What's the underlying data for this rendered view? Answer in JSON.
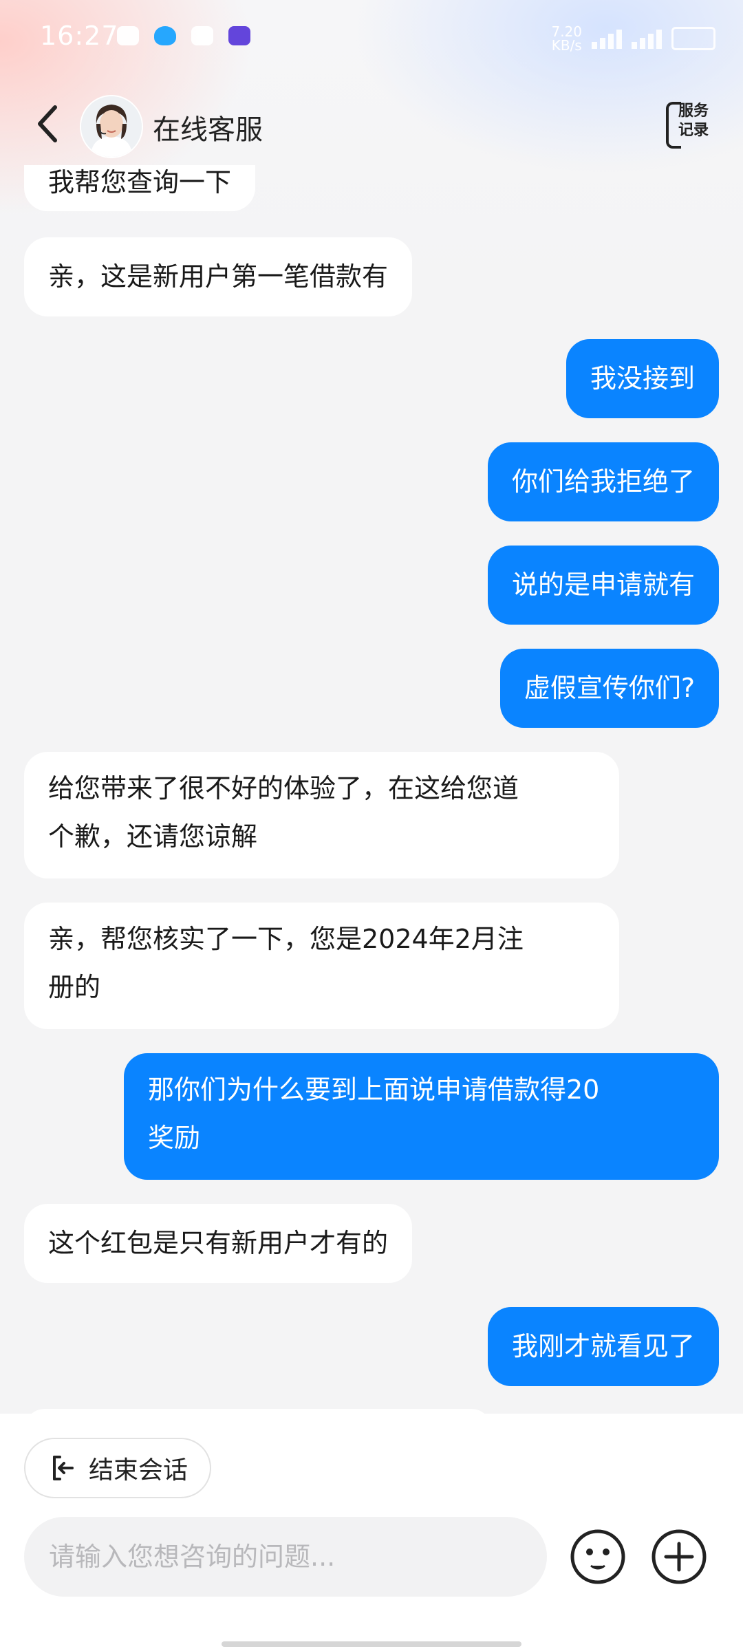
{
  "status_bar": {
    "time": "16:27",
    "net_speed_value": "7.20",
    "net_speed_unit": "KB/s"
  },
  "header": {
    "title": "在线客服",
    "service_record_label_1": "服务",
    "service_record_label_2": "记录"
  },
  "messages": [
    {
      "side": "left",
      "text": "我帮您查询一下"
    },
    {
      "side": "left",
      "text": "亲，这是新用户第一笔借款有"
    },
    {
      "side": "right",
      "text": "我没接到"
    },
    {
      "side": "right",
      "text": "你们给我拒绝了"
    },
    {
      "side": "right",
      "text": "说的是申请就有"
    },
    {
      "side": "right",
      "text": "虚假宣传你们?"
    },
    {
      "side": "left",
      "text_line1": "给您带来了很不好的体验了，在这给您道",
      "text_line2": "个歉，还请您谅解"
    },
    {
      "side": "left",
      "text_line1": "亲，帮您核实了一下，您是2024年2月注",
      "text_line2": "册的"
    },
    {
      "side": "right",
      "text_line1": "那你们为什么要到上面说申请借款得20",
      "text_line2": "奖励"
    },
    {
      "side": "left",
      "text": "这个红包是只有新用户才有的"
    },
    {
      "side": "right",
      "text": "我刚才就看见了"
    }
  ],
  "footer": {
    "end_session_label": "结束会话",
    "input_placeholder": "请输入您想咨询的问题...",
    "input_value": ""
  },
  "colors": {
    "accent": "#0a84ff",
    "bubble_left": "#ffffff",
    "background": "#f4f4f5"
  },
  "icons": [
    "back-arrow-icon",
    "service-record-icon",
    "end-session-icon",
    "emoji-icon",
    "plus-icon"
  ]
}
